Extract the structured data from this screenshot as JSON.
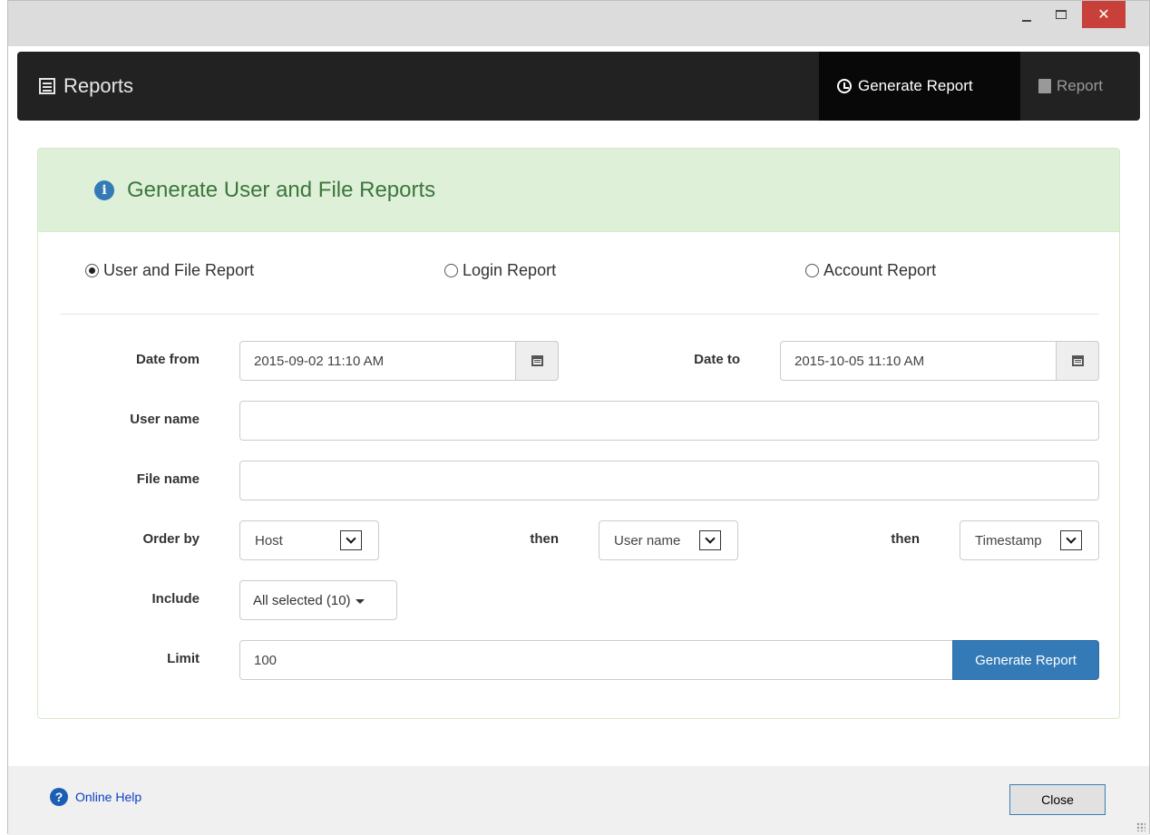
{
  "window": {
    "controls": {
      "minimize": "_",
      "maximize": "□",
      "close": "✕"
    }
  },
  "navbar": {
    "brand": "Reports",
    "brand_icon": "list-icon",
    "tabs": [
      {
        "label": "Generate Report",
        "icon": "dashboard-icon",
        "active": true
      },
      {
        "label": "Report",
        "icon": "book-icon",
        "active": false
      }
    ]
  },
  "panel": {
    "heading": "Generate User and File Reports",
    "heading_icon": "info-icon",
    "colors": {
      "heading_bg": "#dff0d8",
      "heading_text": "#3c763d",
      "info": "#337ab7"
    }
  },
  "report_types": [
    {
      "label": "User and File Report",
      "selected": true
    },
    {
      "label": "Login Report",
      "selected": false
    },
    {
      "label": "Account Report",
      "selected": false
    }
  ],
  "form": {
    "date_from_label": "Date from",
    "date_from_value": "2015-09-02 11:10 AM",
    "date_to_label": "Date to",
    "date_to_value": "2015-10-05 11:10 AM",
    "user_name_label": "User name",
    "user_name_value": "",
    "file_name_label": "File name",
    "file_name_value": "",
    "order_by_label": "Order by",
    "order_by_1": "Host",
    "then_label_1": "then",
    "order_by_2": "User name",
    "then_label_2": "then",
    "order_by_3": "Timestamp",
    "include_label": "Include",
    "include_value": "All selected (10)",
    "limit_label": "Limit",
    "limit_value": "100",
    "generate_button": "Generate Report",
    "primary_color": "#337ab7"
  },
  "footer": {
    "help_link": "Online Help",
    "close_button": "Close"
  }
}
